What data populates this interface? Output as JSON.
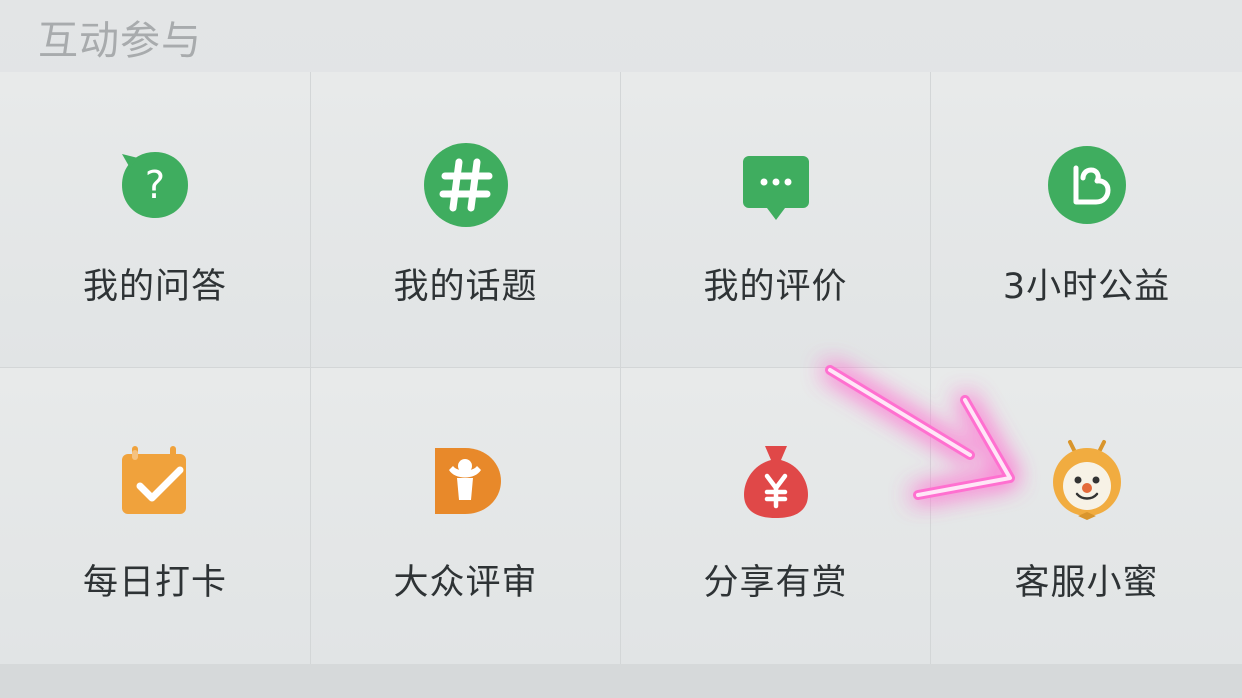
{
  "section": {
    "title": "互动参与"
  },
  "grid": {
    "items": [
      {
        "label": "我的问答",
        "icon": "question-bubble-icon",
        "color": "#3daa5c"
      },
      {
        "label": "我的话题",
        "icon": "hashtag-icon",
        "color": "#3daa5c"
      },
      {
        "label": "我的评价",
        "icon": "comment-icon",
        "color": "#3daa5c"
      },
      {
        "label": "3小时公益",
        "icon": "heart-outline-icon",
        "color": "#3daa5c"
      },
      {
        "label": "每日打卡",
        "icon": "calendar-check-icon",
        "color": "#f0a13a"
      },
      {
        "label": "大众评审",
        "icon": "reviewer-d-icon",
        "color": "#e88a24"
      },
      {
        "label": "分享有赏",
        "icon": "money-bag-icon",
        "color": "#e24b4b"
      },
      {
        "label": "客服小蜜",
        "icon": "bee-mascot-icon",
        "color": "#f0a93a"
      }
    ]
  },
  "annotation": {
    "arrow_color": "#ff5fc8"
  }
}
